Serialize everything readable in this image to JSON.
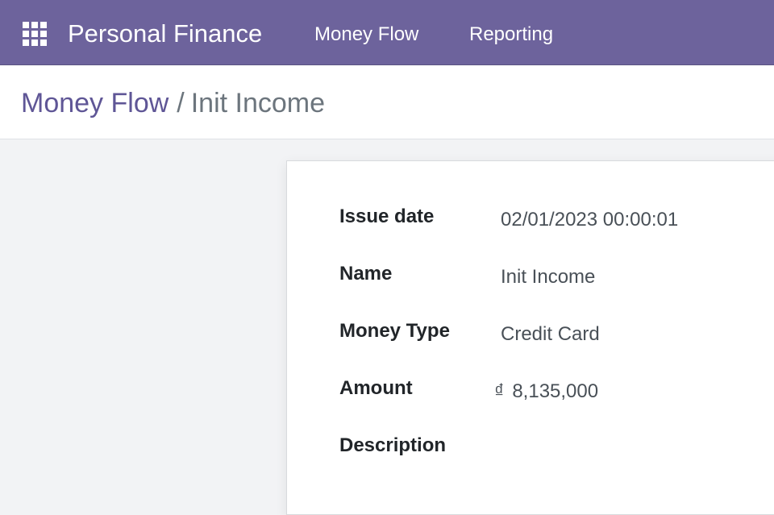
{
  "navbar": {
    "app_title": "Personal Finance",
    "menu": [
      {
        "label": "Money Flow"
      },
      {
        "label": "Reporting"
      }
    ]
  },
  "breadcrumb": {
    "parent": "Money Flow",
    "separator": "/",
    "current": "Init Income"
  },
  "form": {
    "fields": [
      {
        "label": "Issue date",
        "value": "02/01/2023 00:00:01"
      },
      {
        "label": "Name",
        "value": "Init Income"
      },
      {
        "label": "Money Type",
        "value": "Credit Card"
      },
      {
        "label": "Amount",
        "currency": "₫",
        "value": "8,135,000"
      },
      {
        "label": "Description",
        "value": ""
      }
    ]
  },
  "colors": {
    "navbar_bg": "#6d639c",
    "breadcrumb_link": "#5f5696",
    "page_bg": "#f2f3f5"
  }
}
